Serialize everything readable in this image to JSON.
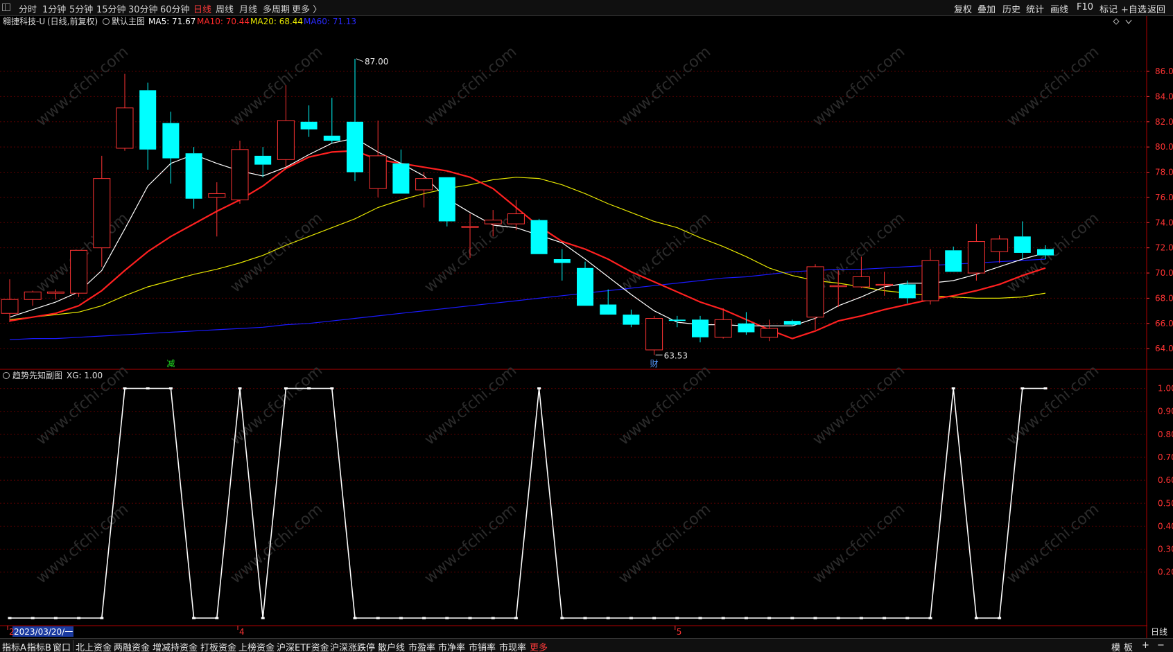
{
  "topbar": {
    "tabs": [
      "分时",
      "1分钟",
      "5分钟",
      "15分钟",
      "30分钟",
      "60分钟",
      "日线",
      "周线",
      "月线",
      "多周期",
      "更多 〉"
    ],
    "active_tab": "日线",
    "right_buttons": [
      "复权",
      "叠加",
      "历史",
      "统计",
      "画线",
      "F10",
      "标记",
      "+自选",
      "返回"
    ]
  },
  "main_panel": {
    "stock_name": "翱捷科技-U",
    "period_info": "(日线,前复权)",
    "indicator_name": "默认主图",
    "ma5": "MA5: 71.67",
    "ma10": "MA10: 70.44",
    "ma20": "MA20: 68.44",
    "ma60": "MA60: 71.13",
    "high_label": "87.00",
    "low_label": "63.53",
    "event_markers": [
      {
        "text": "减",
        "bar": 7,
        "color": "#22dd22"
      },
      {
        "text": "财",
        "bar": 28,
        "color": "#5599ff"
      }
    ],
    "watermark": "www.cfchi.com"
  },
  "sub_panel": {
    "title": "趋势先知副图",
    "xg": "XG: 1.00"
  },
  "time_axis": {
    "date_box": "2023/03/20/一",
    "month_labels": [
      {
        "text": "2",
        "bar": 0
      },
      {
        "text": "4",
        "bar": 10
      },
      {
        "text": "5",
        "bar": 29
      }
    ],
    "period_label": "日线"
  },
  "bottombar": {
    "items": [
      "指标A",
      "指标B",
      "窗口",
      "北上资金",
      "两融资金",
      "增减持资金",
      "打板资金",
      "上榜资金",
      "沪深ETF资金",
      "沪深涨跌停",
      "散户线",
      "市盈率",
      "市净率",
      "市销率",
      "市现率",
      "更多"
    ],
    "right_items": [
      "模",
      "板",
      "+",
      "−"
    ]
  },
  "colors": {
    "up": "#ff3333",
    "down": "#00ffff",
    "ma5": "#ffffff",
    "ma10": "#ff2020",
    "ma20": "#e6e600",
    "ma60": "#1a1aff",
    "grid": "#5a0000",
    "axis_text": "#ff3333"
  },
  "chart_data": {
    "type": "candlestick",
    "price_axis": {
      "ticks": [
        86,
        84,
        82,
        80,
        78,
        76,
        74,
        72,
        70,
        68,
        66,
        64
      ],
      "range": [
        62.8,
        88.2
      ]
    },
    "candles": [
      {
        "o": 66.8,
        "h": 69.5,
        "l": 66.1,
        "c": 67.9
      },
      {
        "o": 67.9,
        "h": 68.6,
        "l": 67.4,
        "c": 68.5
      },
      {
        "o": 68.4,
        "h": 68.7,
        "l": 67.9,
        "c": 68.5
      },
      {
        "o": 68.4,
        "h": 71.8,
        "l": 68.1,
        "c": 71.8
      },
      {
        "o": 72.0,
        "h": 79.3,
        "l": 70.5,
        "c": 77.5
      },
      {
        "o": 79.9,
        "h": 85.8,
        "l": 79.7,
        "c": 83.1
      },
      {
        "o": 84.5,
        "h": 85.1,
        "l": 78.2,
        "c": 79.8
      },
      {
        "o": 81.9,
        "h": 82.8,
        "l": 77.1,
        "c": 79.1
      },
      {
        "o": 79.5,
        "h": 80.0,
        "l": 75.1,
        "c": 75.9
      },
      {
        "o": 76.0,
        "h": 77.2,
        "l": 72.9,
        "c": 76.3
      },
      {
        "o": 75.8,
        "h": 80.5,
        "l": 75.5,
        "c": 79.8
      },
      {
        "o": 79.3,
        "h": 80.0,
        "l": 77.6,
        "c": 78.6
      },
      {
        "o": 79.0,
        "h": 84.9,
        "l": 78.4,
        "c": 82.1
      },
      {
        "o": 82.0,
        "h": 83.3,
        "l": 80.8,
        "c": 81.4
      },
      {
        "o": 80.9,
        "h": 83.9,
        "l": 80.3,
        "c": 80.5
      },
      {
        "o": 82.0,
        "h": 87.0,
        "l": 77.3,
        "c": 78.0
      },
      {
        "o": 76.7,
        "h": 82.1,
        "l": 76.0,
        "c": 79.3
      },
      {
        "o": 78.7,
        "h": 79.8,
        "l": 76.3,
        "c": 76.3
      },
      {
        "o": 76.6,
        "h": 78.0,
        "l": 75.2,
        "c": 77.5
      },
      {
        "o": 77.6,
        "h": 77.6,
        "l": 73.7,
        "c": 74.1
      },
      {
        "o": 73.7,
        "h": 74.7,
        "l": 71.2,
        "c": 73.7
      },
      {
        "o": 73.9,
        "h": 75.0,
        "l": 72.9,
        "c": 74.2
      },
      {
        "o": 73.9,
        "h": 75.8,
        "l": 73.4,
        "c": 74.7
      },
      {
        "o": 74.2,
        "h": 74.3,
        "l": 71.5,
        "c": 71.5
      },
      {
        "o": 71.1,
        "h": 71.9,
        "l": 69.4,
        "c": 70.8
      },
      {
        "o": 70.4,
        "h": 70.9,
        "l": 67.4,
        "c": 67.4
      },
      {
        "o": 67.5,
        "h": 68.7,
        "l": 66.8,
        "c": 66.7
      },
      {
        "o": 66.7,
        "h": 67.1,
        "l": 65.7,
        "c": 65.9
      },
      {
        "o": 63.9,
        "h": 66.6,
        "l": 63.5,
        "c": 66.4
      },
      {
        "o": 66.3,
        "h": 66.6,
        "l": 65.7,
        "c": 66.2
      },
      {
        "o": 66.3,
        "h": 66.6,
        "l": 64.5,
        "c": 64.9
      },
      {
        "o": 64.9,
        "h": 67.2,
        "l": 64.8,
        "c": 66.3
      },
      {
        "o": 66.0,
        "h": 66.9,
        "l": 65.1,
        "c": 65.3
      },
      {
        "o": 64.9,
        "h": 66.3,
        "l": 64.6,
        "c": 65.6
      },
      {
        "o": 66.2,
        "h": 66.3,
        "l": 65.8,
        "c": 65.9
      },
      {
        "o": 66.5,
        "h": 70.7,
        "l": 65.5,
        "c": 70.5
      },
      {
        "o": 69.0,
        "h": 70.2,
        "l": 67.3,
        "c": 69.0
      },
      {
        "o": 68.9,
        "h": 71.3,
        "l": 68.8,
        "c": 69.7
      },
      {
        "o": 69.1,
        "h": 70.1,
        "l": 68.2,
        "c": 69.1
      },
      {
        "o": 69.1,
        "h": 69.4,
        "l": 67.6,
        "c": 68.0
      },
      {
        "o": 67.8,
        "h": 71.9,
        "l": 67.5,
        "c": 71.0
      },
      {
        "o": 71.8,
        "h": 72.1,
        "l": 70.1,
        "c": 70.1
      },
      {
        "o": 70.0,
        "h": 73.9,
        "l": 69.4,
        "c": 72.5
      },
      {
        "o": 71.7,
        "h": 73.0,
        "l": 70.8,
        "c": 72.7
      },
      {
        "o": 72.9,
        "h": 74.1,
        "l": 71.1,
        "c": 71.6
      },
      {
        "o": 71.9,
        "h": 72.2,
        "l": 71.1,
        "c": 71.4
      }
    ],
    "ma5": [
      66.5,
      67.1,
      67.7,
      68.5,
      70.2,
      73.5,
      76.9,
      78.7,
      79.4,
      78.7,
      78.1,
      77.7,
      78.4,
      79.4,
      80.3,
      80.7,
      79.6,
      78.7,
      77.7,
      75.9,
      74.8,
      73.8,
      73.6,
      73.0,
      72.4,
      71.1,
      69.7,
      68.3,
      67.0,
      66.1,
      65.9,
      65.9,
      65.8,
      65.8,
      65.8,
      66.4,
      67.4,
      68.1,
      68.9,
      69.2,
      69.2,
      69.4,
      69.9,
      70.5,
      71.1,
      71.6
    ],
    "ma10": [
      66.2,
      66.5,
      66.8,
      67.4,
      68.6,
      70.2,
      71.7,
      72.9,
      73.9,
      74.9,
      75.8,
      76.9,
      78.3,
      79.2,
      79.6,
      79.7,
      79.0,
      78.7,
      78.4,
      78.1,
      77.6,
      76.7,
      75.2,
      73.7,
      72.5,
      71.9,
      71.1,
      70.1,
      69.3,
      68.5,
      67.7,
      67.1,
      66.3,
      65.5,
      64.8,
      65.4,
      66.2,
      66.6,
      67.1,
      67.5,
      67.9,
      68.2,
      68.6,
      69.1,
      69.8,
      70.4
    ],
    "ma20": [
      66.3,
      66.5,
      66.7,
      66.9,
      67.4,
      68.2,
      68.9,
      69.4,
      69.9,
      70.3,
      70.8,
      71.4,
      72.2,
      72.9,
      73.6,
      74.3,
      75.2,
      75.8,
      76.3,
      76.7,
      77.0,
      77.4,
      77.6,
      77.5,
      77.0,
      76.3,
      75.5,
      74.8,
      74.1,
      73.6,
      72.8,
      72.1,
      71.3,
      70.4,
      69.8,
      69.4,
      69.2,
      68.9,
      68.6,
      68.4,
      68.2,
      68.1,
      68.0,
      68.0,
      68.1,
      68.4
    ],
    "ma60": [
      64.7,
      64.8,
      64.8,
      64.9,
      65.0,
      65.1,
      65.2,
      65.3,
      65.4,
      65.5,
      65.6,
      65.7,
      65.9,
      66.0,
      66.2,
      66.4,
      66.6,
      66.8,
      67.0,
      67.2,
      67.4,
      67.6,
      67.8,
      68.0,
      68.2,
      68.4,
      68.6,
      68.8,
      69.0,
      69.2,
      69.4,
      69.6,
      69.7,
      69.9,
      70.1,
      70.2,
      70.3,
      70.3,
      70.4,
      70.5,
      70.6,
      70.7,
      70.8,
      70.9,
      71.0,
      71.1
    ],
    "sub_axis": {
      "ticks": [
        1.0,
        0.9,
        0.8,
        0.7,
        0.6,
        0.5,
        0.4,
        0.3,
        0.2
      ],
      "range": [
        0,
        1.05
      ]
    },
    "xg": [
      0,
      0,
      0,
      0,
      0,
      1,
      1,
      1,
      0,
      0,
      1,
      0,
      1,
      1,
      1,
      0,
      0,
      0,
      0,
      0,
      0,
      0,
      0,
      1,
      0,
      0,
      0,
      0,
      0,
      0,
      0,
      0,
      0,
      0,
      0,
      0,
      0,
      0,
      0,
      0,
      0,
      1,
      0,
      0,
      1,
      1
    ]
  }
}
